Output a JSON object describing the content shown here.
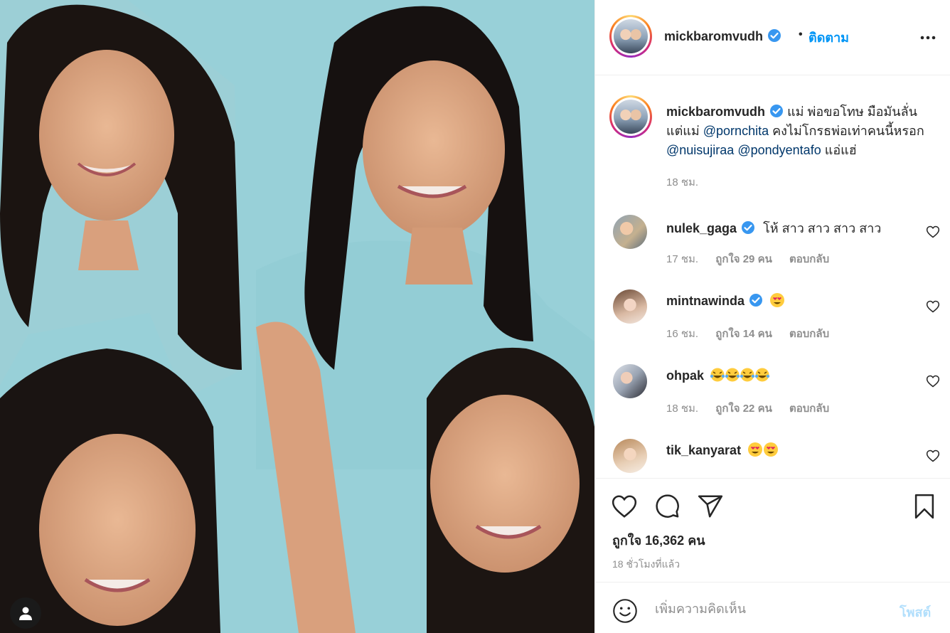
{
  "post": {
    "username": "mickbaromvudh",
    "follow_label": "ติดตาม",
    "separator": "•",
    "caption": {
      "text_1": "แม่ พ่อขอโทษ มือมันลั่น แต่แม่ ",
      "mention_1": "@pornchita",
      "text_2": " คงไม่โกรธพ่อเท่าคนนี้หรอก ",
      "mention_2": "@nuisujiraa",
      "mention_3": "@pondyentafo",
      "text_3": " แอ่แฮ่",
      "time": "18 ชม."
    },
    "comments": [
      {
        "user": "nulek_gaga",
        "verified": true,
        "text": "โห้ สาว สาว สาว สาว",
        "emoji": "",
        "time": "17 ชม.",
        "likes": "ถูกใจ 29 คน",
        "reply": "ตอบกลับ"
      },
      {
        "user": "mintnawinda",
        "verified": true,
        "text": "",
        "emoji": "heart-eyes",
        "time": "16 ชม.",
        "likes": "ถูกใจ 14 คน",
        "reply": "ตอบกลับ"
      },
      {
        "user": "ohpak",
        "verified": false,
        "text": "",
        "emoji": "laughing-tears x4",
        "time": "18 ชม.",
        "likes": "ถูกใจ 22 คน",
        "reply": "ตอบกลับ"
      },
      {
        "user": "tik_kanyarat",
        "verified": false,
        "text": "",
        "emoji": "heart-eyes x2",
        "time": "",
        "likes": "",
        "reply": ""
      }
    ],
    "likes_text": "ถูกใจ 16,362 คน",
    "posted_ago": "18 ชั่วโมงที่แล้ว",
    "add_comment": {
      "placeholder": "เพิ่มความคิดเห็น",
      "post_label": "โพสต์"
    }
  },
  "colors": {
    "link": "#0095f6",
    "mention": "#00376b",
    "muted": "#8e8e8e",
    "verified": "#3897f0",
    "post_disabled": "#b2dffc"
  },
  "icons": [
    "verified-badge-icon",
    "more-options-icon",
    "heart-icon",
    "comment-icon",
    "share-icon",
    "bookmark-icon",
    "emoji-icon",
    "user-tag-icon"
  ]
}
